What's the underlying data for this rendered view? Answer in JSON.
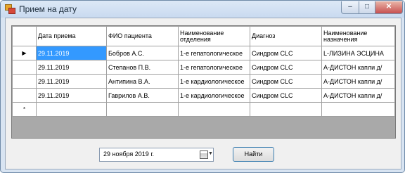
{
  "window": {
    "title": "Прием на дату",
    "min_glyph": "–",
    "max_glyph": "□",
    "close_glyph": "✕"
  },
  "grid": {
    "columns": [
      "Дата приема",
      "ФИО пациента",
      "Наименование отделения",
      "Диагноз",
      "Наименование назначения"
    ],
    "rows": [
      [
        "29.11.2019",
        "Бобров А.С.",
        "1-е гепатологическое",
        "Синдром CLC",
        "L-ЛИЗИНА ЭСЦИНА"
      ],
      [
        "29.11.2019",
        "Степанов П.В.",
        "1-е гепатологическое",
        "Синдром CLC",
        "А-ДИСТОН капли д/"
      ],
      [
        "29.11.2019",
        "Антипина В.А.",
        "1-е кардиологическое",
        "Синдром CLC",
        "А-ДИСТОН капли д/"
      ],
      [
        "29.11.2019",
        "Гаврилов А.В.",
        "1-е кардиологическое",
        "Синдром CLC",
        "А-ДИСТОН капли д/"
      ]
    ],
    "current_row_marker": "▶",
    "new_row_marker": "*"
  },
  "date_picker": {
    "value": "29   ноября   2019 г.",
    "arrow": "▼"
  },
  "find_button": {
    "label": "Найти"
  }
}
